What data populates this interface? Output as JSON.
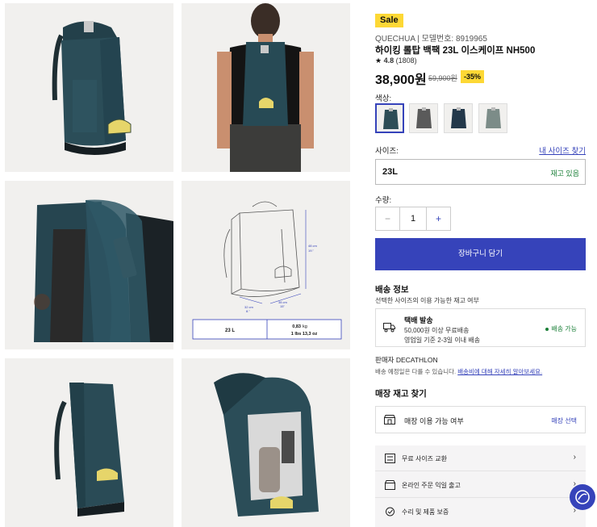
{
  "product": {
    "sale_badge": "Sale",
    "brand_line": "QUECHUA | 모델번호: 8919965",
    "title": "하이킹 롤탑 백팩 23L 이스케이프 NH500",
    "rating_star": "★",
    "rating_value": "4.8",
    "rating_count": "(1808)",
    "price": "38,900원",
    "old_price": "59,900원",
    "discount": "-35%"
  },
  "colors": {
    "label": "색상:",
    "swatches": [
      {
        "name": "teal",
        "hex": "#2d4d57",
        "selected": true
      },
      {
        "name": "grey",
        "hex": "#5a5a5a",
        "selected": false
      },
      {
        "name": "navy",
        "hex": "#23384a",
        "selected": false
      },
      {
        "name": "sage",
        "hex": "#7c8c88",
        "selected": false
      }
    ]
  },
  "size": {
    "label": "사이즈:",
    "link": "내 사이즈 찾기",
    "value": "23L",
    "stock": "재고 있음"
  },
  "quantity": {
    "label": "수량:",
    "minus": "−",
    "value": "1",
    "plus": "+"
  },
  "cart_button": "장바구니 담기",
  "shipping": {
    "heading": "배송 정보",
    "subtext": "선택한 사이즈의 이용 가능한 재고 여부",
    "method": "택배 발송",
    "free_note": "50,000원 이상 무료배송",
    "eta": "영업일 기준 2-3일 이내 배송",
    "availability": "배송 가능"
  },
  "seller": "판매자 DECATHLON",
  "delivery_note": {
    "text": "배송 예정일은 다를 수 있습니다.",
    "link": "배송비에 대해 자세히 알아보세요."
  },
  "store": {
    "heading": "매장 재고 찾기",
    "label": "매장 이용 가능 여부",
    "action": "매장 선택"
  },
  "services": [
    {
      "icon": "size-exchange-icon",
      "label": "무료 사이즈 교환"
    },
    {
      "icon": "store-pickup-icon",
      "label": "온라인 주문 익일 출고"
    },
    {
      "icon": "repair-icon",
      "label": "수리 및 제품 보증"
    }
  ],
  "diagram": {
    "size_label": "23 L",
    "weight_kg": "0,83",
    "weight_kg_unit": "kg",
    "weight_lbs": "1 lbs 13,3 oz",
    "height_cm": "48 cm",
    "height_in": "19.\"",
    "width_cm": "32 cm",
    "width_in": "8.\"",
    "depth_cm": "38 cm",
    "depth_in": "15\""
  },
  "accent": "#3643ba",
  "sale_yellow": "#fdd835"
}
